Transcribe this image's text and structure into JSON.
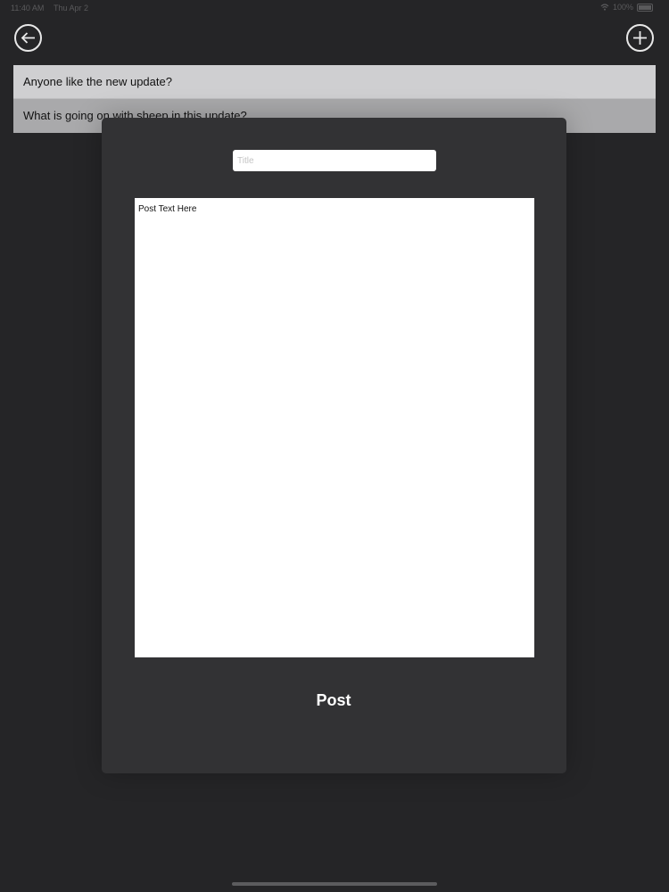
{
  "status_bar": {
    "time": "11:40 AM",
    "date": "Thu Apr 2",
    "battery": "100%"
  },
  "nav": {
    "back_icon": "arrow-left-icon",
    "add_icon": "plus-icon",
    "icon_color": "#e8e8e8"
  },
  "posts": [
    {
      "title": "Anyone like the new update?"
    },
    {
      "title": "What is going on with sheep in this update?"
    }
  ],
  "modal": {
    "title_placeholder": "Title",
    "title_value": "",
    "body_text": "Post Text Here",
    "post_label": "Post"
  }
}
